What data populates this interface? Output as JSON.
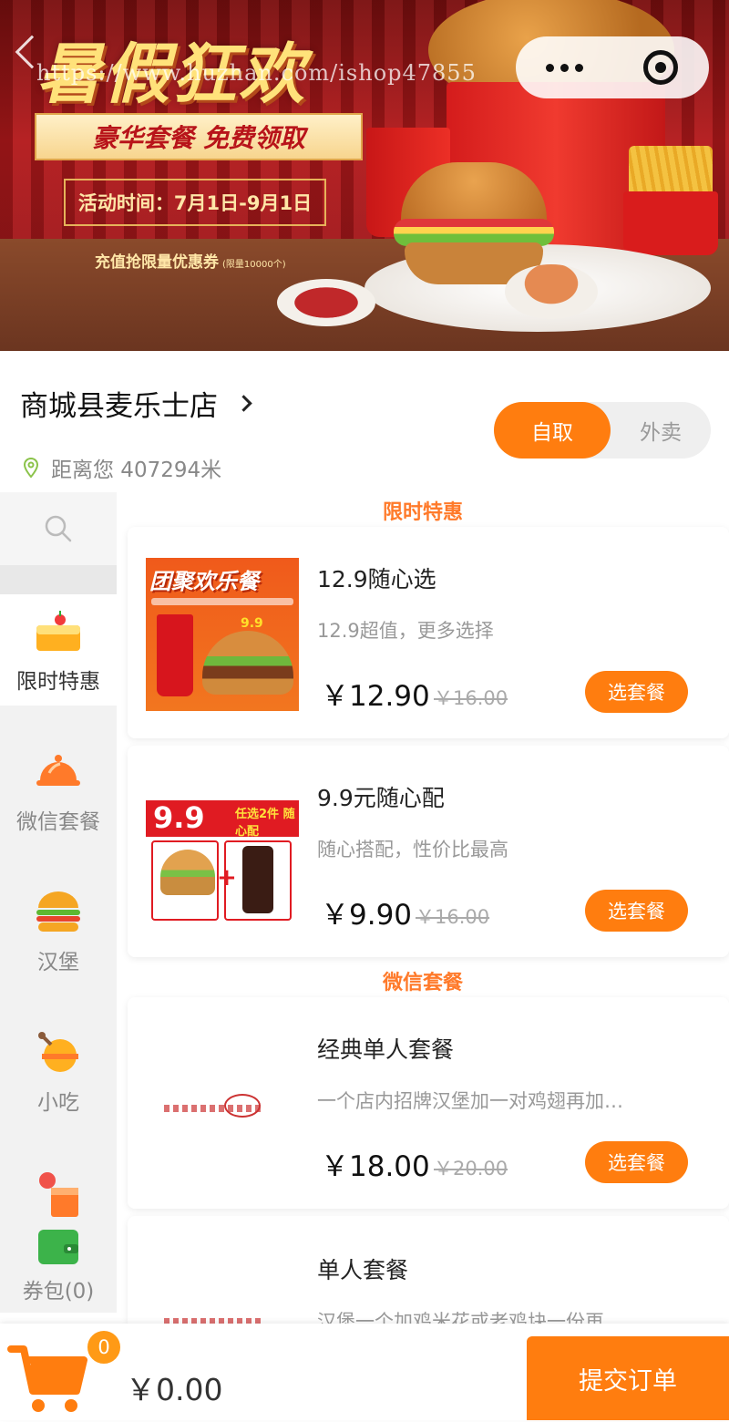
{
  "banner": {
    "title": "暑假狂欢",
    "subtitle": "豪华套餐 免费领取",
    "event_time": "活动时间：7月1日-9月1日",
    "coupon": "充值抢限量优惠券",
    "coupon_limit": "(限量10000个)",
    "watermark": "https://www.huzhan.com/ishop47855"
  },
  "store": {
    "name": "商城县麦乐士店",
    "distance": "距离您 407294米",
    "modes": [
      "自取",
      "外卖"
    ],
    "active_mode": "自取"
  },
  "sidebar": {
    "items": [
      {
        "label": "限时特惠",
        "icon": "cake-icon",
        "active": true
      },
      {
        "label": "微信套餐",
        "icon": "cloche-icon",
        "active": false
      },
      {
        "label": "汉堡",
        "icon": "burger-icon",
        "active": false
      },
      {
        "label": "小吃",
        "icon": "drumstick-icon",
        "active": false
      },
      {
        "label": "券包(0)",
        "icon": "wallet-icon",
        "active": false
      }
    ]
  },
  "sections": [
    {
      "title": "限时特惠",
      "products": [
        {
          "name": "12.9随心选",
          "desc": "12.9超值，更多选择",
          "price": "￥12.90",
          "old_price": "￥16.00",
          "button": "选套餐",
          "thumb_title": "团聚欢乐餐",
          "thumb_price": "9.9"
        },
        {
          "name": "9.9元随心配",
          "desc": "随心搭配，性价比最高",
          "price": "￥9.90",
          "old_price": "￥16.00",
          "button": "选套餐",
          "thumb_title": "9.9",
          "thumb_label": "任选2件 随心配"
        }
      ]
    },
    {
      "title": "微信套餐",
      "products": [
        {
          "name": "经典单人套餐",
          "desc": "一个店内招牌汉堡加一对鸡翅再加…",
          "price": "￥18.00",
          "old_price": "￥20.00",
          "button": "选套餐"
        },
        {
          "name": "单人套餐",
          "desc": "汉堡一个加鸡米花或老鸡块一份再…",
          "price": "",
          "old_price": "",
          "button": ""
        }
      ]
    }
  ],
  "cart": {
    "count": "0",
    "total": "￥0.00",
    "submit": "提交订单"
  },
  "colors": {
    "accent": "#ff7d0f",
    "section_title": "#ff7a2a",
    "banner_red": "#b3191b"
  }
}
